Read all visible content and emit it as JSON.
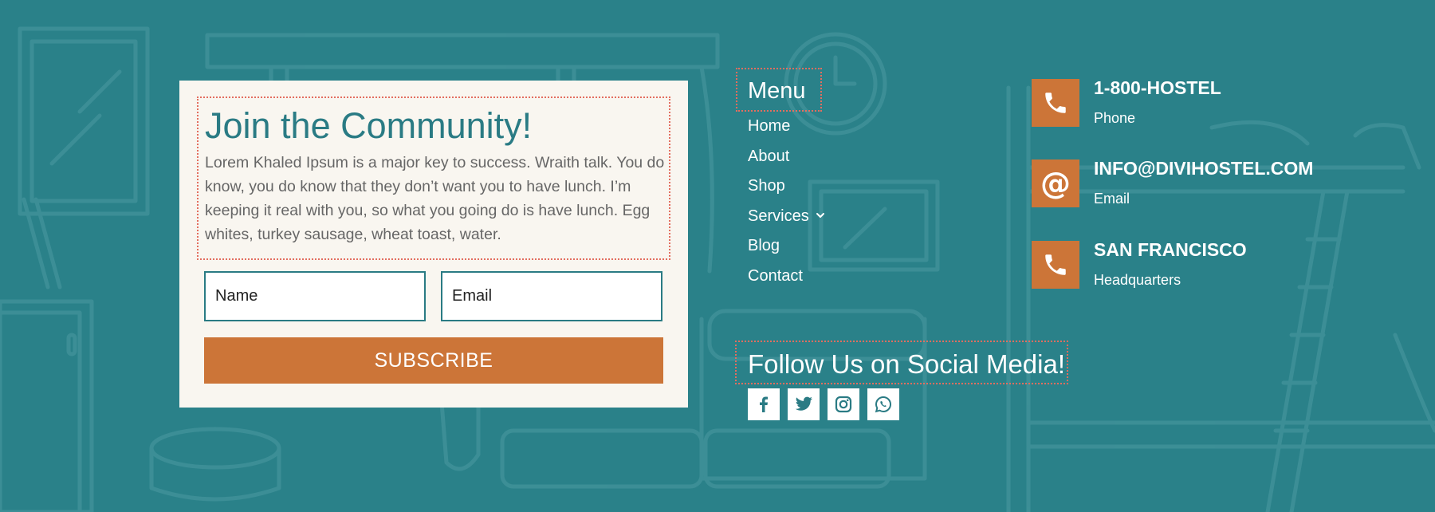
{
  "colors": {
    "background": "#2a8189",
    "card": "#f9f6f0",
    "accent": "#cc7538",
    "teal_text": "#2a7b84",
    "dotted_outline": "#e36e5f"
  },
  "community": {
    "title": "Join the Community!",
    "text": "Lorem Khaled Ipsum is a major key to success. Wraith talk. You do know, you do know that they don’t want you to have lunch. I’m keeping it real with you, so what you going do is have lunch. Egg whites, turkey sausage, wheat toast, water.",
    "name_placeholder": "Name",
    "email_placeholder": "Email",
    "subscribe_label": "SUBSCRIBE"
  },
  "menu": {
    "title": "Menu",
    "items": [
      "Home",
      "About",
      "Shop",
      "Services",
      "Blog",
      "Contact"
    ]
  },
  "social": {
    "title": "Follow Us on Social Media!",
    "icons": [
      "facebook-icon",
      "twitter-icon",
      "instagram-icon",
      "whatsapp-icon"
    ]
  },
  "contacts": [
    {
      "icon": "phone-icon",
      "heading": "1-800-HOSTEL",
      "sub": "Phone"
    },
    {
      "icon": "at-sign-icon",
      "heading": "INFO@DIVIHOSTEL.COM",
      "sub": "Email"
    },
    {
      "icon": "phone-icon",
      "heading": "SAN FRANCISCO",
      "sub": "Headquarters"
    }
  ]
}
